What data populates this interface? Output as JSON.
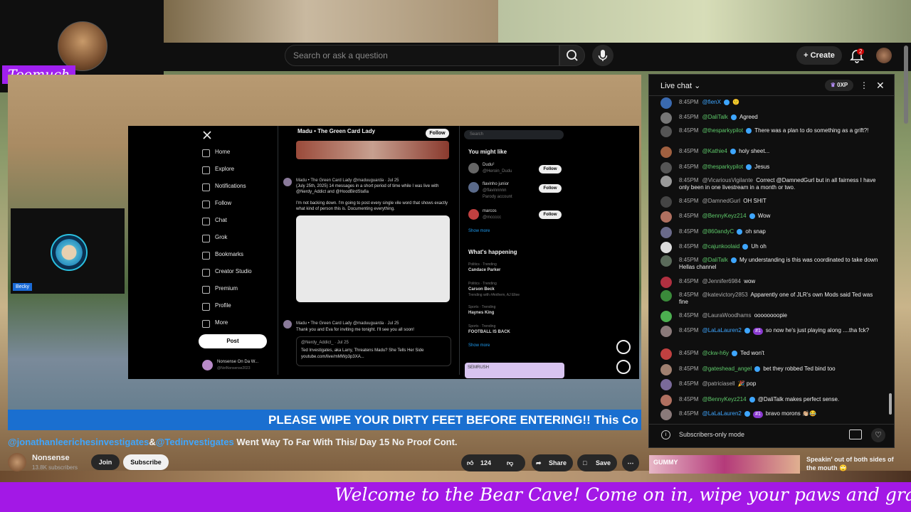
{
  "overlay": {
    "streamer_name": "Toomuch"
  },
  "search": {
    "placeholder": "Search or ask a question"
  },
  "header": {
    "create_label": "Create",
    "notification_count": "2"
  },
  "player": {
    "ticker_text": "PLEASE WIPE YOUR DIRTY FEET BEFORE ENTERING!! This Co",
    "cam_label": "Becky",
    "x_page": {
      "nav": [
        "Home",
        "Explore",
        "Notifications",
        "Follow",
        "Chat",
        "Grok",
        "Bookmarks",
        "Creator Studio",
        "Premium",
        "Profile",
        "More"
      ],
      "post_label": "Post",
      "profile_name": "Nonsense On Da W...",
      "profile_handle": "@NotNonsense2023",
      "header_title": "Madu • The Green Card Lady",
      "follow_label": "Follow",
      "tweet1_head": "Madu • The Green Card Lady @maduuguarda · Jul 25",
      "tweet1_body": "(July 25th, 2025) 14 messages in a short period of time while I was live with @Nerdy_Addict and @HoodBirdStafia",
      "tweet1_body2": "I'm not backing down. I'm going to post every single vile word that shows exactly what kind of person this is. Documenting everything.",
      "tweet2_head": "Madu • The Green Card Lady @maduuguarda · Jul 25",
      "tweet2_body": "Thank you and Eva for inviting me tonight. I'll see you all soon!",
      "quote_head": "@Nerdy_Addict_ · Jul 25",
      "quote_body": "Ted Investigates, aka Larry, Threatens Madu? She Tells Her Side",
      "quote_link": "youtube.com/live/mMWp3p3XA...",
      "search_placeholder": "Search",
      "might_like": "You might like",
      "suggestions": [
        {
          "name": "Dudu²",
          "handle": "@Heroin_Dudu"
        },
        {
          "name": "flavinho junior",
          "handle": "@flavinnnnn",
          "note": "Parody account"
        },
        {
          "name": "marcos",
          "handle": "@mccccc"
        }
      ],
      "show_more": "Show more",
      "happening": "What's happening",
      "trends": [
        {
          "cat": "Politics · Trending",
          "name": "Candace Parker"
        },
        {
          "cat": "Politics · Trending",
          "name": "Carson Beck",
          "posts": "Trending with #Anthem, AJ Ellee"
        },
        {
          "cat": "Sports · Trending",
          "name": "Haynes King"
        },
        {
          "cat": "Sports · Trending",
          "name": "FOOTBALL IS BACK"
        }
      ],
      "ad_label": "SEMRUSH"
    }
  },
  "video": {
    "title_mention1": "@jonathanleerichesinvestigates",
    "title_amp": "&",
    "title_mention2": "@Tedinvestigates",
    "title_rest": " Went Way To Far With This/ Day 15 No Proof Cont.",
    "channel_name": "Nonsense",
    "subscribers": "13.8K subscribers",
    "join_label": "Join",
    "subscribe_label": "Subscribe",
    "likes": "124",
    "share_label": "Share",
    "save_label": "Save"
  },
  "chat": {
    "title": "Live chat",
    "xp": "0XP",
    "footer_text": "Subscribers-only mode",
    "messages": [
      {
        "time": "8:45PM",
        "author": "@fienX",
        "text": "🙂",
        "color": "#3ea6ff"
      },
      {
        "time": "8:45PM",
        "author": "@DaliTalk",
        "text": "Agreed",
        "color": "#5ec96a"
      },
      {
        "time": "8:45PM",
        "author": "@thesparkypilot",
        "text": "There was a plan to do something as a grift?!",
        "color": "#5ec96a"
      },
      {
        "time": "8:45PM",
        "author": "@Kathie4",
        "text": "holy sheet...",
        "color": "#5ec96a"
      },
      {
        "time": "8:45PM",
        "author": "@thesparkypilot",
        "text": "Jesus",
        "color": "#5ec96a"
      },
      {
        "time": "8:45PM",
        "author": "@VicariousVigilante",
        "text": "Correct @DamnedGurl but in all fairness I have only been in one livestream in a month or two.",
        "color": "#aaaaaa"
      },
      {
        "time": "8:45PM",
        "author": "@DamnedGurl",
        "text": "OH SHIT",
        "color": "#aaaaaa"
      },
      {
        "time": "8:45PM",
        "author": "@BennyKeyz214",
        "text": "Wow",
        "color": "#5ec96a"
      },
      {
        "time": "8:45PM",
        "author": "@860andyC",
        "text": "oh snap",
        "color": "#5ec96a"
      },
      {
        "time": "8:45PM",
        "author": "@cajunkoolaid",
        "text": "Uh oh",
        "color": "#5ec96a"
      },
      {
        "time": "8:45PM",
        "author": "@DaliTalk",
        "text": "My understanding is this was coordinated to take down Hellas channel",
        "color": "#5ec96a"
      },
      {
        "time": "8:45PM",
        "author": "@Jennifer6984",
        "text": "wow",
        "color": "#aaaaaa"
      },
      {
        "time": "8:45PM",
        "author": "@katevictory2853",
        "text": "Apparently one of JLR's own Mods said Ted was fine",
        "color": "#aaaaaa"
      },
      {
        "time": "8:45PM",
        "author": "@LauraWoodhams",
        "text": "oooooooopie",
        "color": "#aaaaaa"
      },
      {
        "time": "8:45PM",
        "author": "@LaLaLauren2",
        "text": "so now he's just playing along ....tha fck?",
        "color": "#3ea6ff",
        "rank": "#1"
      },
      {
        "time": "8:45PM",
        "author": "@ckw-h6y",
        "text": "Ted won't",
        "color": "#5ec96a"
      },
      {
        "time": "8:45PM",
        "author": "@gateshead_angel",
        "text": "bet they robbed Ted bind too",
        "color": "#5ec96a"
      },
      {
        "time": "8:45PM",
        "author": "@patriciasell",
        "text": "🎉 pop",
        "color": "#aaaaaa"
      },
      {
        "time": "8:45PM",
        "author": "@BennyKeyz214",
        "text": "@DaliTalk makes perfect sense.",
        "color": "#5ec96a"
      },
      {
        "time": "8:45PM",
        "author": "@LaLaLauren2",
        "text": "bravo morons 👏🏼😂",
        "color": "#3ea6ff",
        "rank": "#1"
      }
    ]
  },
  "upnext": {
    "thumb_text": "GUMMY",
    "title": "Speakin' out of both sides of the mouth 🙄"
  },
  "banner": {
    "text": "Welcome to the Bear Cave! Come on in, wipe your paws and grab a rocking c"
  }
}
